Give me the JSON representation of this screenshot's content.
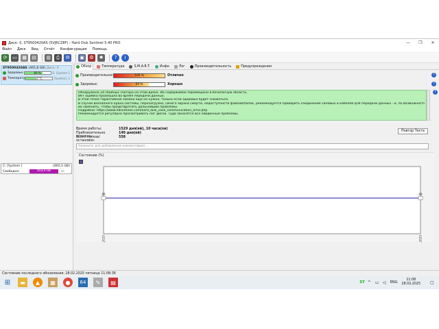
{
  "window": {
    "title": "Диск: 0, ST9500420AS (5VJ6CZ8F) - Hard Disk Sentinel 5.40 PRO",
    "controls": [
      "—",
      "❐",
      "✕"
    ]
  },
  "menu": [
    "Файл",
    "Диск",
    "Вид",
    "Отчёт",
    "Конфигурация",
    "Помощь"
  ],
  "disk_card": {
    "name": "ST9500420AS",
    "size": "(465,8 GB)",
    "current": "Диск: 0",
    "health_label": "Здоровье:",
    "health_value": "69 %",
    "health_pct": 69,
    "health_side": "E: [System 1",
    "temp_label": "Температура:",
    "temp_value": "37 °C",
    "temp_pct": 37,
    "temp_side": "[System], 1"
  },
  "volume": {
    "name": "C: [System ]",
    "size": "(465,5 GB)",
    "free_label": "Свободно:",
    "free_value": "454,4 GB"
  },
  "tabs": [
    "Обзор",
    "Температура",
    "S.M.A.R.T.",
    "Инфо",
    "Лог",
    "Производительность",
    "Предупреждения"
  ],
  "performance": {
    "label": "Производительность:",
    "value": "100 %",
    "pct": 100,
    "status": "Отлично"
  },
  "health": {
    "label": "Здоровье:",
    "value": "69 %",
    "pct": 69,
    "status": "Хорошо"
  },
  "messages": [
    "Обнаружено 24 сбойных сектора на этом диске. Их содержимое перемещено в безопасную область.",
    "897 ошибка произошла во время передачи данных.",
    "В этой точке гарантийная замена ещё не нужна, только если здоровье будет снижаться.",
    "В случае внезапного краха системы, перезагрузки, синего экрана смерти, недоступности файлов/папок, рекомендуется проверить соединения силовых и кабелей для передачи данных - и, по возможности, попробовать",
    "их заменить, чтобы предотвратить дальнейшие проблемы.",
    "Подробно: https://www.hdsentinel.com/hard_disk_case_communication_error.php",
    "Рекомендуется регулярно просматривать Лог диска. Туда заносятся все найденные проблемы."
  ],
  "stats": [
    {
      "key": "Время работы:",
      "value": "1529 дня(ей), 10 часа(ов)"
    },
    {
      "key": "Приблизительно осталось:",
      "value": "140 дня(ей)"
    },
    {
      "key": "Всего пусков/остановок:",
      "value": "558"
    }
  ],
  "repeat_test_label": "Повтор Теста",
  "comment_placeholder": "Нажмите для добавления комментария ...",
  "chart_data": {
    "type": "line",
    "title": "Состояние (%)",
    "x": [
      "27.02.2025",
      "28.02.2025"
    ],
    "series": [
      {
        "values": [
          69,
          69
        ]
      }
    ],
    "point_labels": [
      "69",
      "69"
    ],
    "color": "#1a1aa0"
  },
  "status_bar": "Состояние последнего обновления: 28.02.2025 пятница 11:08:36",
  "taskbar": {
    "apps": [
      "windows",
      "file-explorer",
      "media-player",
      "total-commander",
      "chrome",
      "aida64",
      "tools",
      "hdsentinel"
    ],
    "tray_number": "37",
    "lang": "ENG",
    "time": "11:08",
    "date": "28.02.2025"
  },
  "colors": {
    "good_green": "#b8f0b8",
    "accent_blue": "#2a62c9",
    "free_magenta": "#b018b0"
  }
}
